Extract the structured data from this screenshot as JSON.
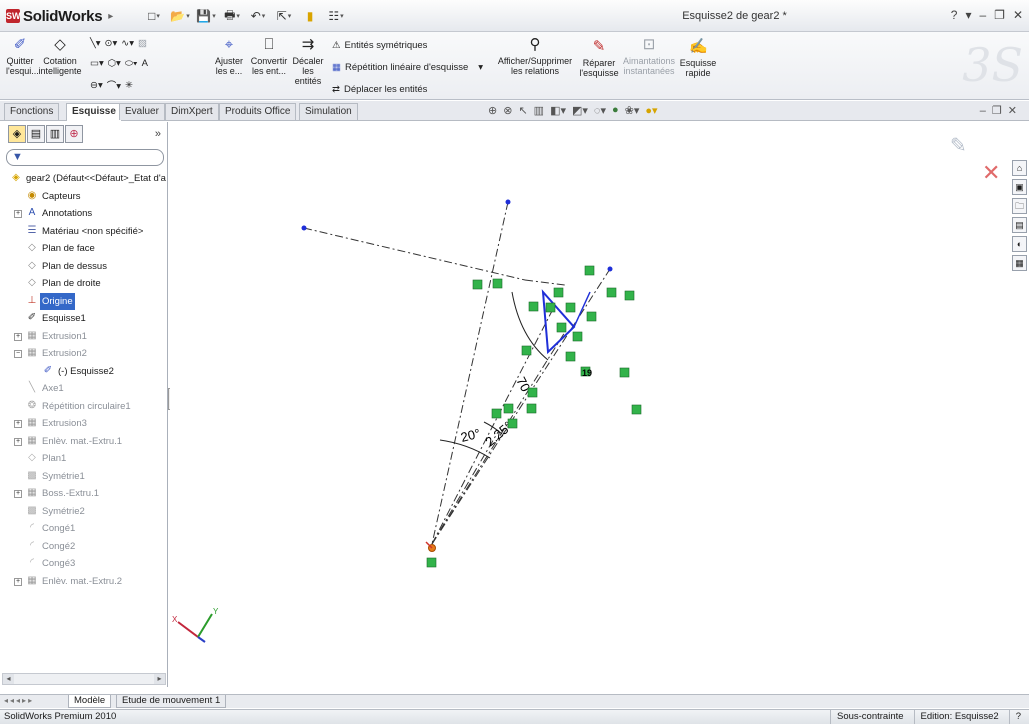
{
  "app": {
    "brand": "SolidWorks",
    "document_title": "Esquisse2 de gear2 *",
    "window_controls": [
      "?",
      "▾",
      "–",
      "🗗",
      "✕"
    ]
  },
  "ribbon": {
    "quit_sketch": "Quitter l'esqui...",
    "smart_dimension": "Cotation intelligente",
    "trim": "Ajuster les e...",
    "convert": "Convertir les ent...",
    "offset": "Décaler les entités",
    "mirror": "Entités symétriques",
    "linear_pattern": "Répétition linéaire d'esquisse",
    "move": "Déplacer les entités",
    "show_relations": "Afficher/Supprimer les relations",
    "repair": "Réparer l'esquisse",
    "snaps": "Aimantations instantanées",
    "quick_sketch": "Esquisse rapide"
  },
  "tabs": [
    "Fonctions",
    "Esquisse",
    "Evaluer",
    "DimXpert",
    "Produits Office",
    "Simulation"
  ],
  "active_tab": "Esquisse",
  "tree": {
    "root": "gear2 (Défaut<<Défaut>_Etat d'a",
    "items": [
      {
        "label": "Capteurs"
      },
      {
        "label": "Annotations"
      },
      {
        "label": "Matériau <non spécifié>"
      },
      {
        "label": "Plan de face"
      },
      {
        "label": "Plan de dessus"
      },
      {
        "label": "Plan de droite"
      },
      {
        "label": "Origine"
      },
      {
        "label": "Esquisse1"
      },
      {
        "label": "Extrusion1"
      },
      {
        "label": "Extrusion2"
      },
      {
        "label": "(-) Esquisse2"
      },
      {
        "label": "Axe1"
      },
      {
        "label": "Répétition circulaire1"
      },
      {
        "label": "Extrusion3"
      },
      {
        "label": "Enlèv. mat.-Extru.1"
      },
      {
        "label": "Plan1"
      },
      {
        "label": "Symétrie1"
      },
      {
        "label": "Boss.-Extru.1"
      },
      {
        "label": "Symétrie2"
      },
      {
        "label": "Congé1"
      },
      {
        "label": "Congé2"
      },
      {
        "label": "Congé3"
      },
      {
        "label": "Enlèv. mat.-Extru.2"
      }
    ]
  },
  "canvas": {
    "dim_angle_1": "70°",
    "dim_angle_2": "20°",
    "dim_angle_3": "2.25°",
    "relation_19": "19",
    "axis_x": "X",
    "axis_y": "Y"
  },
  "bottom_tabs": [
    "Modèle",
    "Etude de mouvement 1"
  ],
  "status": {
    "product": "SolidWorks Premium 2010",
    "state": "Sous-contrainte",
    "edit": "Edition: Esquisse2",
    "help": "?"
  },
  "colors": {
    "accent": "#3468c8",
    "sketch_blue": "#1f2fd8",
    "relation_green": "#32b34a",
    "origin_red": "#d0342c"
  }
}
